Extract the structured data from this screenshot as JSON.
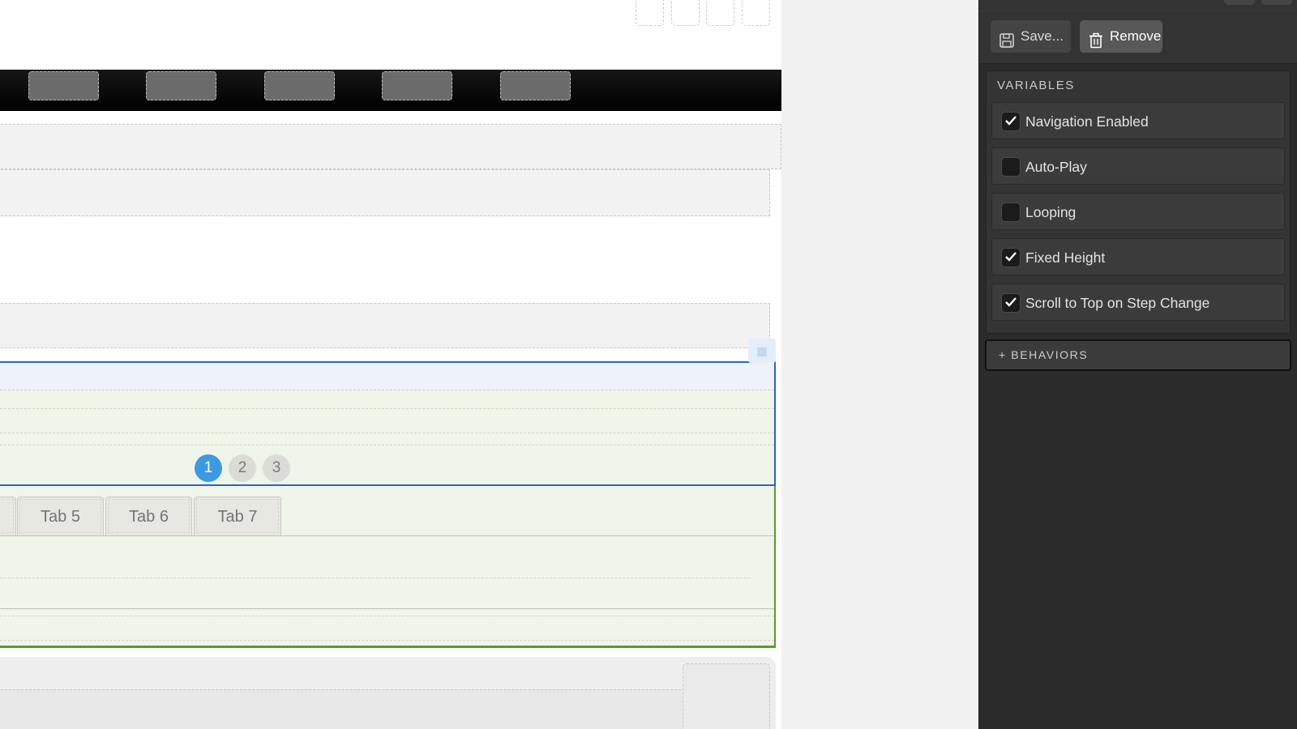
{
  "canvas": {
    "pagination": {
      "pages": [
        "1",
        "2",
        "3"
      ],
      "active": "1"
    },
    "tabs": [
      "Tab 5",
      "Tab 6",
      "Tab 7"
    ]
  },
  "panel": {
    "toolbar": {
      "save_label": "Save...",
      "save_icon": "floppy-disk-icon",
      "remove_label": "Remove",
      "remove_icon": "trash-icon"
    },
    "variables": {
      "title": "VARIABLES",
      "items": [
        {
          "label": "Navigation Enabled",
          "checked": true
        },
        {
          "label": "Auto-Play",
          "checked": false
        },
        {
          "label": "Looping",
          "checked": false
        },
        {
          "label": "Fixed Height",
          "checked": true
        },
        {
          "label": "Scroll to Top on Step Change",
          "checked": true
        }
      ]
    },
    "behaviors_label": "+ BEHAVIORS"
  },
  "colors": {
    "panel_bg": "#2b2b2b",
    "stepper_border": "#2a63c9",
    "tabs_border": "#5c9a2e",
    "active_dot": "#3d9ae2"
  }
}
